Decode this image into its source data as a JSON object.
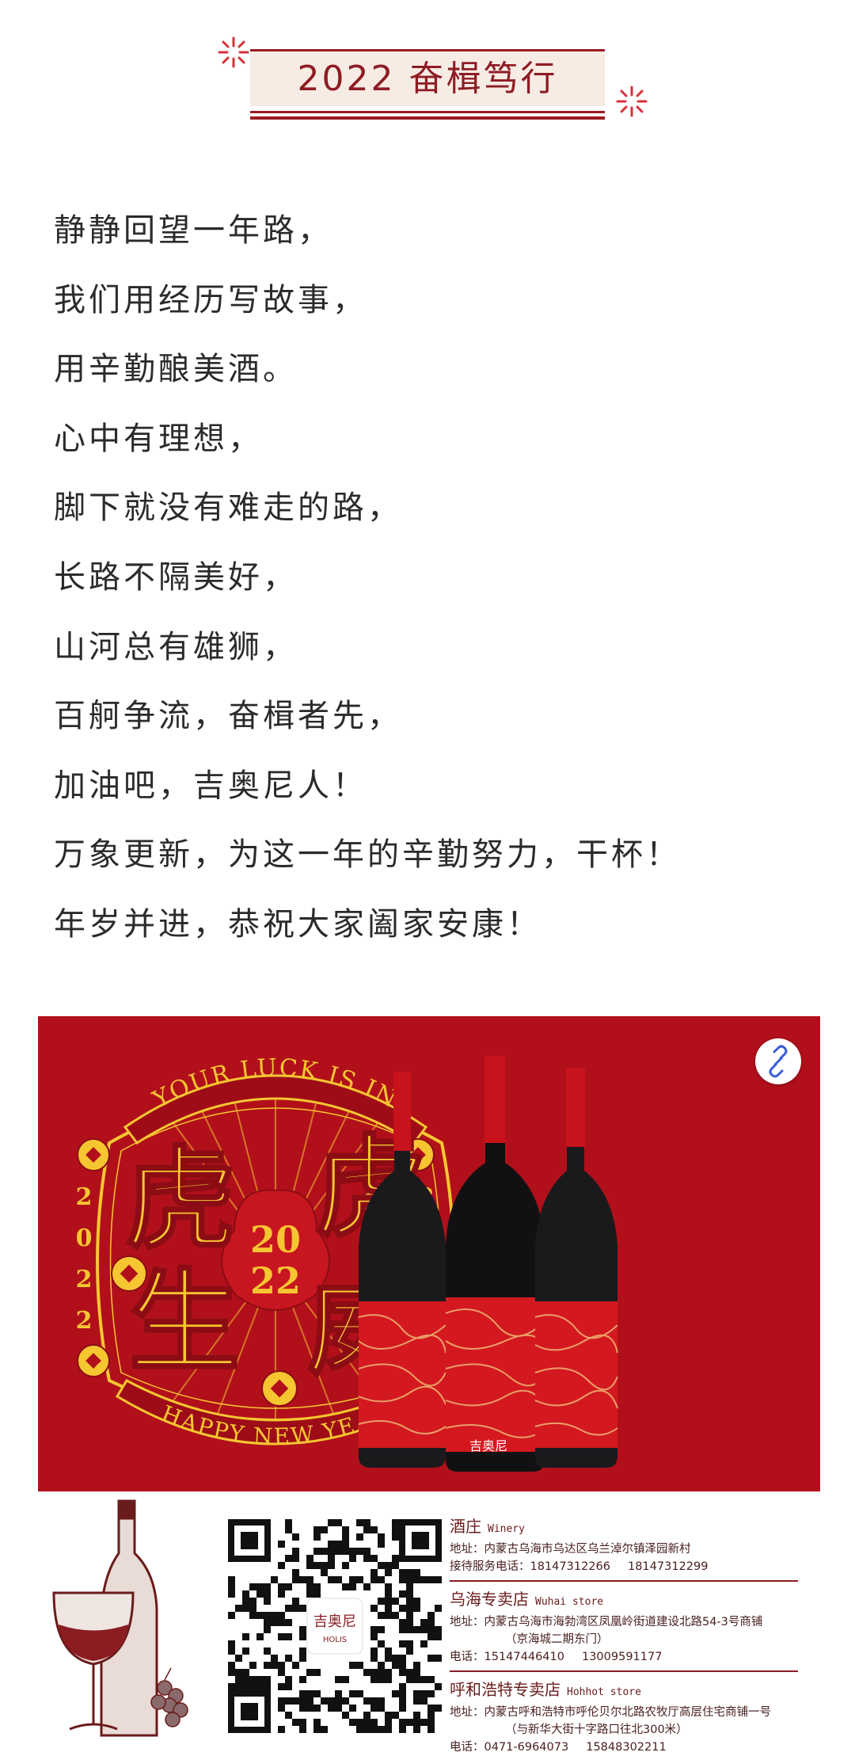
{
  "heading": {
    "title": "2022 奋楫笃行"
  },
  "poem": {
    "lines": [
      "静静回望一年路，",
      "我们用经历写故事，",
      "用辛勤酿美酒。",
      "心中有理想，",
      "脚下就没有难走的路，",
      "长路不隔美好，",
      "山河总有雄狮，",
      "百舸争流，奋楫者先，",
      "加油吧，吉奥尼人！",
      "万象更新，为这一年的辛勤努力，干杯！",
      "年岁并进，恭祝大家阖家安康！"
    ]
  },
  "poster": {
    "arc_top": "YOUR LUCK IS IN",
    "arc_bottom": "HAPPY NEW YEAR",
    "chars": [
      "虎",
      "虎",
      "生",
      "威"
    ],
    "year_center": [
      "20",
      "22"
    ],
    "year_side": [
      "2",
      "0",
      "2",
      "2"
    ],
    "link_icon": "link-icon",
    "bottle_brand": "吉奥尼",
    "bottle_vertical": "HOLIS 吉奥尼",
    "colors": {
      "background": "#b1101b",
      "gold": "#f6c631",
      "dark_red": "#8c0c14"
    }
  },
  "footer": {
    "qr_logo": "吉奥尼",
    "qr_logo_sub": "HOLIS",
    "stores": [
      {
        "name": "酒庄",
        "name_en": "Winery",
        "lines": [
          {
            "text": "地址：内蒙古乌海市乌达区乌兰淖尔镇泽园新村"
          },
          {
            "text": "接待服务电话：18147312266",
            "extra": "18147312299"
          }
        ]
      },
      {
        "name": "乌海专卖店",
        "name_en": "Wuhai store",
        "lines": [
          {
            "text": "地址：内蒙古乌海市海勃湾区凤凰岭街道建设北路54-3号商铺"
          },
          {
            "text": "（京海城二期东门）",
            "indent": true
          },
          {
            "text": "电话：15147446410",
            "extra": "13009591177"
          }
        ]
      },
      {
        "name": "呼和浩特专卖店",
        "name_en": "Hohhot store",
        "lines": [
          {
            "text": "地址：内蒙古呼和浩特市呼伦贝尔北路农牧厅高层住宅商铺一号"
          },
          {
            "text": "（与新华大街十字路口往北300米）",
            "indent": true
          },
          {
            "text": "电话：0471-6964073",
            "extra": "15848302211"
          }
        ]
      }
    ]
  }
}
